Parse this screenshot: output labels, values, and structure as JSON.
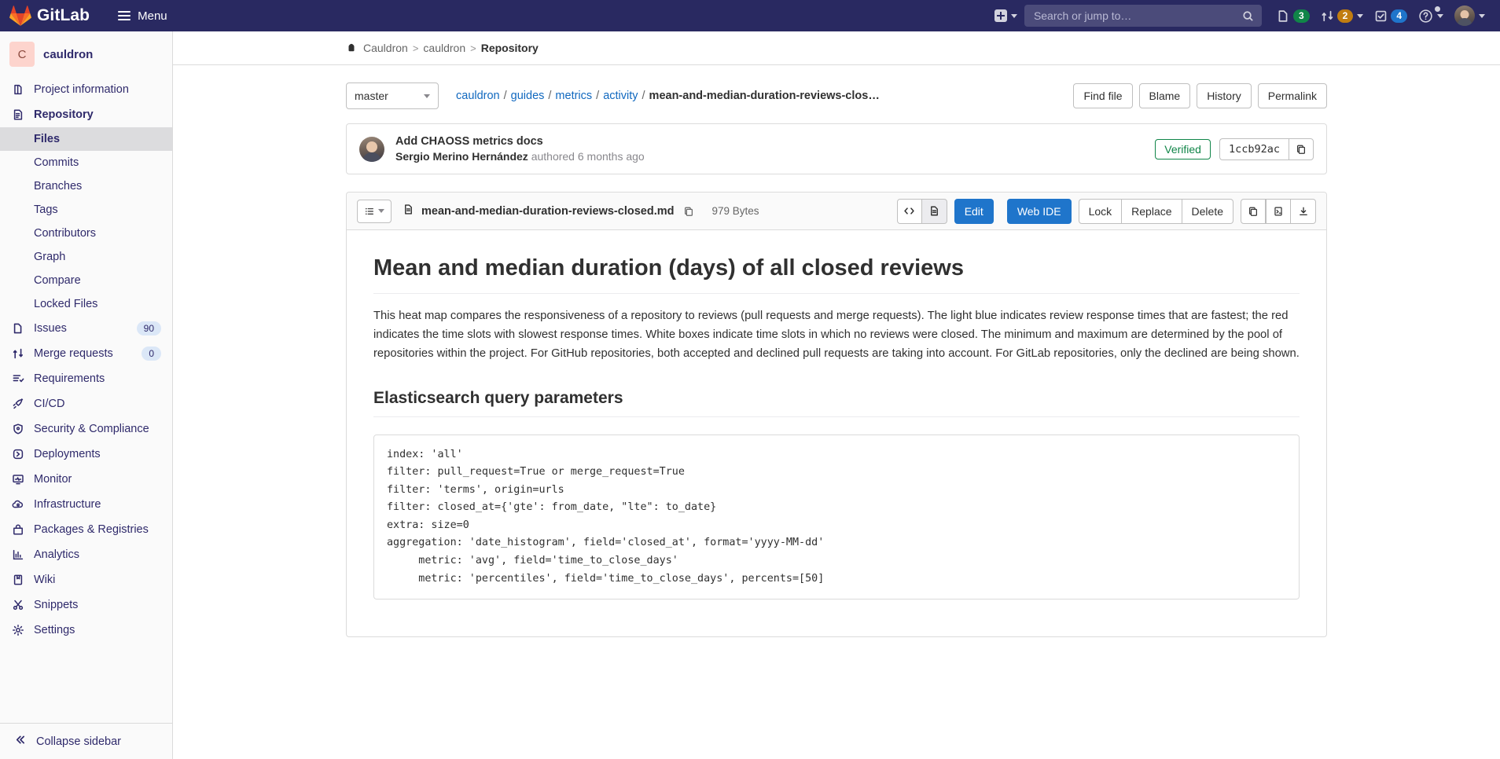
{
  "navbar": {
    "brand": "GitLab",
    "menu_label": "Menu",
    "create_new_label": "Create new...",
    "search": {
      "placeholder": "Search or jump to…",
      "value": ""
    },
    "issues_count": "3",
    "merge_requests_count": "2",
    "todos_count": "4",
    "help_label": "Help",
    "user_label": "User menu",
    "colors": {
      "navbar_bg": "#292961",
      "issues_badge": "#108548",
      "mr_badge": "#c17d10",
      "todos_badge": "#1f75cb"
    }
  },
  "sidebar": {
    "project_initial": "C",
    "project_name": "cauldron",
    "items": [
      {
        "label": "Project information",
        "icon": "project-icon",
        "count": ""
      },
      {
        "label": "Repository",
        "icon": "repository-icon",
        "count": ""
      },
      {
        "label": "Issues",
        "icon": "issues-icon",
        "count": "90"
      },
      {
        "label": "Merge requests",
        "icon": "merge-request-icon",
        "count": "0"
      },
      {
        "label": "Requirements",
        "icon": "requirements-icon",
        "count": ""
      },
      {
        "label": "CI/CD",
        "icon": "rocket-icon",
        "count": ""
      },
      {
        "label": "Security & Compliance",
        "icon": "shield-icon",
        "count": ""
      },
      {
        "label": "Deployments",
        "icon": "deployments-icon",
        "count": ""
      },
      {
        "label": "Monitor",
        "icon": "monitor-icon",
        "count": ""
      },
      {
        "label": "Infrastructure",
        "icon": "cloud-icon",
        "count": ""
      },
      {
        "label": "Packages & Registries",
        "icon": "package-icon",
        "count": ""
      },
      {
        "label": "Analytics",
        "icon": "chart-icon",
        "count": ""
      },
      {
        "label": "Wiki",
        "icon": "book-icon",
        "count": ""
      },
      {
        "label": "Snippets",
        "icon": "scissors-icon",
        "count": ""
      },
      {
        "label": "Settings",
        "icon": "gear-icon",
        "count": ""
      }
    ],
    "repository_subitems": [
      "Files",
      "Commits",
      "Branches",
      "Tags",
      "Contributors",
      "Graph",
      "Compare",
      "Locked Files"
    ],
    "active_subitem": "Files",
    "collapse_label": "Collapse sidebar"
  },
  "breadcrumb": {
    "group": "Cauldron",
    "project": "cauldron",
    "current": "Repository"
  },
  "tree": {
    "branch": "master",
    "path_parts": [
      "cauldron",
      "guides",
      "metrics",
      "activity"
    ],
    "file_name_truncated": "mean-and-median-duration-reviews-clos…",
    "actions": [
      "Find file",
      "Blame",
      "History",
      "Permalink"
    ]
  },
  "commit": {
    "title": "Add CHAOSS metrics docs",
    "author": "Sergio Merino Hernández",
    "meta_suffix": "authored 6 months ago",
    "verified_label": "Verified",
    "sha": "1ccb92ac",
    "copy_label": "Copy commit SHA"
  },
  "blob": {
    "file_name": "mean-and-median-duration-reviews-closed.md",
    "size": "979 Bytes",
    "copy_path_label": "Copy file path",
    "view_source_label": "Display source",
    "view_rendered_label": "Display rendered file",
    "edit_label": "Edit",
    "web_ide_label": "Web IDE",
    "lock_label": "Lock",
    "replace_label": "Replace",
    "delete_label": "Delete",
    "copy_contents_label": "Copy file contents",
    "open_raw_label": "Open raw",
    "download_label": "Download"
  },
  "document": {
    "h1": "Mean and median duration (days) of all closed reviews",
    "paragraph": "This heat map compares the responsiveness of a repository to reviews (pull requests and merge requests). The light blue indicates review response times that are fastest; the red indicates the time slots with slowest response times. White boxes indicate time slots in which no reviews were closed. The minimum and maximum are determined by the pool of repositories within the project. For GitHub repositories, both accepted and declined pull requests are taking into account. For GitLab repositories, only the declined are being shown.",
    "h2": "Elasticsearch query parameters",
    "code": "index: 'all'\nfilter: pull_request=True or merge_request=True\nfilter: 'terms', origin=urls\nfilter: closed_at={'gte': from_date, \"lte\": to_date}\nextra: size=0\naggregation: 'date_histogram', field='closed_at', format='yyyy-MM-dd'\n     metric: 'avg', field='time_to_close_days'\n     metric: 'percentiles', field='time_to_close_days', percents=[50]"
  }
}
